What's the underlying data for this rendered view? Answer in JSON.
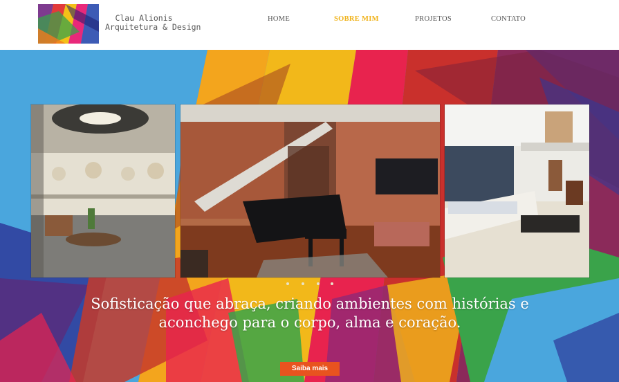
{
  "brand": {
    "line1": "Clau Alionis",
    "line2": "Arquitetura & Design"
  },
  "nav": {
    "items": [
      {
        "label": "HOME",
        "active": false
      },
      {
        "label": "SOBRE MIM",
        "active": true
      },
      {
        "label": "PROJETOS",
        "active": false
      },
      {
        "label": "CONTATO",
        "active": false
      }
    ]
  },
  "hero": {
    "headline": "Sofisticação que abraça, criando ambientes com histórias e aconchego para o corpo, alma e coração.",
    "cta_label": "Saiba mais",
    "slide_count": 4,
    "active_slide": 1
  },
  "colors": {
    "accent": "#f0b31c",
    "cta": "#e8531f",
    "nav_text": "#555555"
  }
}
